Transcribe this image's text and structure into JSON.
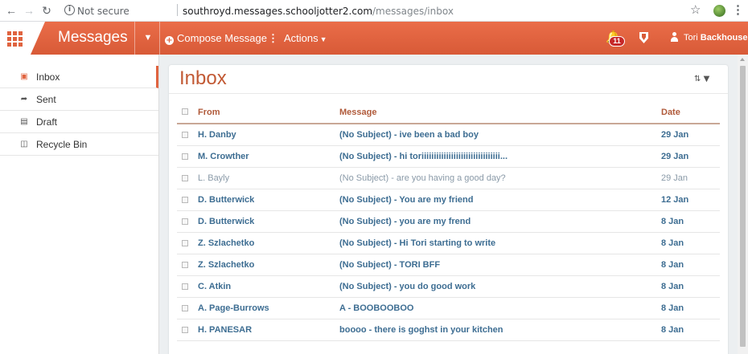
{
  "browser": {
    "security_label": "Not secure",
    "url_host": "southroyd.messages.schooljotter2.com",
    "url_path": "/messages/inbox",
    "icons": [
      "back-icon",
      "forward-icon",
      "reload-icon",
      "info-icon",
      "star-icon",
      "profile-avatar",
      "kebab-menu-icon"
    ]
  },
  "header": {
    "app_title": "Messages",
    "compose_label": "Compose Message",
    "actions_label": "Actions",
    "notification_count": "11",
    "user_first": "Tori",
    "user_last": "Backhouse",
    "accent_color": "#e0633f"
  },
  "sidebar": {
    "items": [
      {
        "label": "Inbox",
        "icon": "inbox-icon",
        "active": true
      },
      {
        "label": "Sent",
        "icon": "reply-arrow-icon",
        "active": false
      },
      {
        "label": "Draft",
        "icon": "save-icon",
        "active": false
      },
      {
        "label": "Recycle Bin",
        "icon": "trash-icon",
        "active": false
      }
    ]
  },
  "inbox": {
    "title": "Inbox",
    "columns": {
      "from": "From",
      "message": "Message",
      "date": "Date"
    },
    "rows": [
      {
        "from": "H. Danby",
        "message": "(No Subject) - ive been a bad boy",
        "date": "29 Jan",
        "unread": true
      },
      {
        "from": "M. Crowther",
        "message": "(No Subject) - hi toriiiiiiiiiiiiiiiiiiiiiiiiiiiiiiii...",
        "date": "29 Jan",
        "unread": true
      },
      {
        "from": "L. Bayly",
        "message": "(No Subject) - are you having a good day?",
        "date": "29 Jan",
        "unread": false
      },
      {
        "from": "D. Butterwick",
        "message": "(No Subject) - You are my friend",
        "date": "12 Jan",
        "unread": true
      },
      {
        "from": "D. Butterwick",
        "message": "(No Subject) - you are my frend",
        "date": "8 Jan",
        "unread": true
      },
      {
        "from": "Z. Szlachetko",
        "message": "(No Subject) - Hi Tori starting to write",
        "date": "8 Jan",
        "unread": true
      },
      {
        "from": "Z. Szlachetko",
        "message": "(No Subject) - TORI BFF",
        "date": "8 Jan",
        "unread": true
      },
      {
        "from": "C. Atkin",
        "message": "(No Subject) - you do good work",
        "date": "8 Jan",
        "unread": true
      },
      {
        "from": "A. Page-Burrows",
        "message": "A - BOOBOOBOO",
        "date": "8 Jan",
        "unread": true
      },
      {
        "from": "H. PANESAR",
        "message": "boooo - there is goghst in your kitchen",
        "date": "8 Jan",
        "unread": true
      }
    ]
  }
}
